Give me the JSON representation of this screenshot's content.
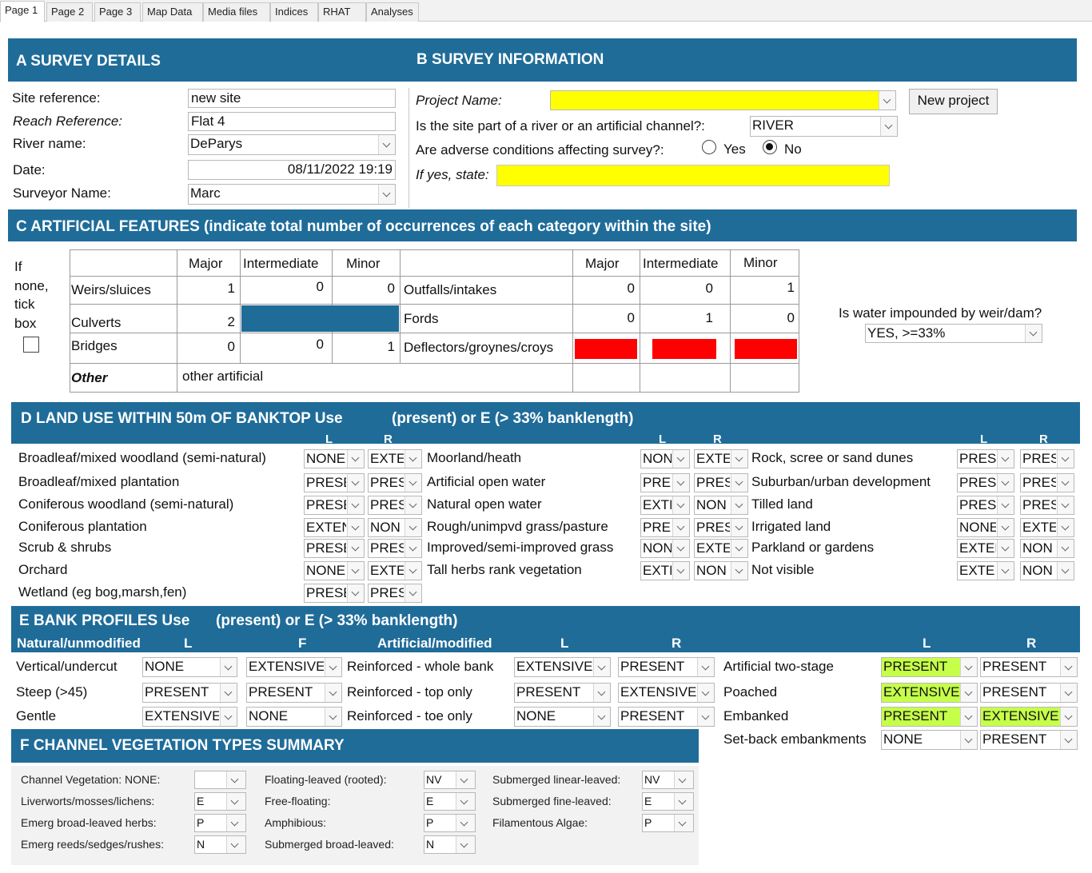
{
  "tabs": [
    "Page 1",
    "Page 2",
    "Page 3",
    "Map Data",
    "Media files",
    "Indices",
    "RHAT",
    "Analyses"
  ],
  "sectionA": {
    "title": "A  SURVEY DETAILS",
    "site_reference_label": "Site reference:",
    "site_reference": "new site",
    "reach_reference_label": "Reach Reference:",
    "reach_reference": "Flat 4",
    "river_name_label": "River name:",
    "river_name": "DeParys",
    "date_label": "Date:",
    "date": "08/11/2022 19:19",
    "surveyor_label": "Surveyor Name:",
    "surveyor": "Marc"
  },
  "sectionB": {
    "title": "B  SURVEY INFORMATION",
    "project_label": "Project Name:",
    "project_value": "",
    "new_project_label": "New project",
    "site_type_label": "Is the site part of a river or an artificial channel?:",
    "site_type": "RIVER",
    "adverse_label": "Are adverse conditions affecting survey?:",
    "yes_label": "Yes",
    "no_label": "No",
    "adverse_selected": "No",
    "if_yes_label": "If yes, state:",
    "if_yes_value": ""
  },
  "sectionC": {
    "title": "C  ARTIFICIAL FEATURES (indicate total number of occurrences of each category within the site)",
    "if_none_lines": [
      "If",
      "none,",
      "tick",
      "box"
    ],
    "col_headers": [
      "Major",
      "Intermediate",
      "Minor"
    ],
    "left_rows": [
      {
        "label": "Weirs/sluices",
        "major": "1",
        "intermediate": "0",
        "minor": "0"
      },
      {
        "label": "Culverts",
        "major": "2"
      },
      {
        "label": "Bridges",
        "major": "0",
        "intermediate": "0",
        "minor": "1"
      }
    ],
    "right_rows": [
      {
        "label": "Outfalls/intakes",
        "major": "0",
        "intermediate": "0",
        "minor": "1"
      },
      {
        "label": "Fords",
        "major": "0",
        "intermediate": "1",
        "minor": "0"
      },
      {
        "label": "Deflectors/groynes/croys",
        "major": "",
        "intermediate": "",
        "minor": ""
      }
    ],
    "other_label": "Other",
    "other_value": "other artificial",
    "impounded_label": "Is water impounded by weir/dam?",
    "impounded_value": "YES, >=33%"
  },
  "sectionD": {
    "title_pre": "D  LAND USE WITHIN 50m OF BANKTOP  Use",
    "title_post": "(present) or E (> 33% banklength)",
    "L": "L",
    "R": "R",
    "col1": [
      {
        "label": "Broadleaf/mixed woodland (semi-natural)",
        "l": "NONE",
        "r": "EXTE"
      },
      {
        "label": "Broadleaf/mixed plantation",
        "l": "PRESE",
        "r": "PRES"
      },
      {
        "label": "Coniferous woodland (semi-natural)",
        "l": "PRESE",
        "r": "PRES"
      },
      {
        "label": "Coniferous plantation",
        "l": "EXTEN",
        "r": "NON"
      },
      {
        "label": "Scrub & shrubs",
        "l": "PRESE",
        "r": "PRES"
      },
      {
        "label": "Orchard",
        "l": "NONE",
        "r": "EXTE"
      },
      {
        "label": "Wetland (eg bog,marsh,fen)",
        "l": "PRESE",
        "r": "PRES"
      }
    ],
    "col2": [
      {
        "label": "Moorland/heath",
        "l": "NON",
        "r": "EXTE"
      },
      {
        "label": "Artificial open water",
        "l": "PRES",
        "r": "PRES"
      },
      {
        "label": "Natural open water",
        "l": "EXTI",
        "r": "NON"
      },
      {
        "label": "Rough/unimpvd grass/pasture",
        "l": "PRES",
        "r": "PRES"
      },
      {
        "label": "Improved/semi-improved grass",
        "l": "NON",
        "r": "EXTE"
      },
      {
        "label": "Tall herbs rank vegetation",
        "l": "EXTI",
        "r": "NON"
      }
    ],
    "col3": [
      {
        "label": "Rock, scree or sand dunes",
        "l": "PRESI",
        "r": "PRES"
      },
      {
        "label": "Suburban/urban development",
        "l": "PRESE",
        "r": "PRES"
      },
      {
        "label": "Tilled land",
        "l": "PRESE",
        "r": "PRES"
      },
      {
        "label": "Irrigated land",
        "l": "NONE",
        "r": "EXTE"
      },
      {
        "label": "Parkland or gardens",
        "l": "EXTEN",
        "r": "NON"
      },
      {
        "label": "Not visible",
        "l": "EXTEI",
        "r": "NON"
      }
    ]
  },
  "sectionE": {
    "title_pre": "E  BANK PROFILES  Use",
    "title_post": "(present) or E (> 33% banklength)",
    "natural_label": "Natural/unmodified",
    "artificial_label": "Artificial/modified",
    "L": "L",
    "R": "R",
    "R_cut": "F",
    "natural": [
      {
        "label": "Vertical/undercut",
        "l": "NONE",
        "r": "EXTENSIVE"
      },
      {
        "label": "Steep (>45)",
        "l": "PRESENT",
        "r": "PRESENT"
      },
      {
        "label": "Gentle",
        "l": "EXTENSIVE",
        "r": "NONE"
      }
    ],
    "artificial": [
      {
        "label": "Reinforced - whole bank",
        "l": "EXTENSIVE",
        "r": "PRESENT"
      },
      {
        "label": "Reinforced - top only",
        "l": "PRESENT",
        "r": "EXTENSIVE"
      },
      {
        "label": "Reinforced - toe only",
        "l": "NONE",
        "r": "PRESENT"
      }
    ],
    "other": [
      {
        "label": "Artificial two-stage",
        "l": "PRESENT",
        "r": "PRESENT"
      },
      {
        "label": "Poached",
        "l": "EXTENSIVE",
        "r": "PRESENT"
      },
      {
        "label": "Embanked",
        "l": "PRESENT",
        "r": "EXTENSIVE"
      },
      {
        "label": "Set-back embankments",
        "l": "NONE",
        "r": "PRESENT"
      }
    ]
  },
  "sectionF": {
    "title": "F CHANNEL VEGETATION TYPES SUMMARY",
    "col1": [
      {
        "label": "Channel Vegetation: NONE:",
        "value": ""
      },
      {
        "label": "Liverworts/mosses/lichens:",
        "value": "E"
      },
      {
        "label": "Emerg broad-leaved herbs:",
        "value": "P"
      },
      {
        "label": "Emerg reeds/sedges/rushes:",
        "value": "N"
      }
    ],
    "col2": [
      {
        "label": "Floating-leaved (rooted):",
        "value": "NV"
      },
      {
        "label": "Free-floating:",
        "value": "E"
      },
      {
        "label": "Amphibious:",
        "value": "P"
      },
      {
        "label": "Submerged broad-leaved:",
        "value": "N"
      }
    ],
    "col3": [
      {
        "label": "Submerged linear-leaved:",
        "value": "NV"
      },
      {
        "label": "Submerged fine-leaved:",
        "value": "E"
      },
      {
        "label": "Filamentous Algae:",
        "value": "P"
      }
    ]
  },
  "colors": {
    "band": "#1f6c99",
    "highlight_yellow": "#ffff00",
    "highlight_green": "#c6ff4a",
    "flag_red": "#ff0000"
  }
}
